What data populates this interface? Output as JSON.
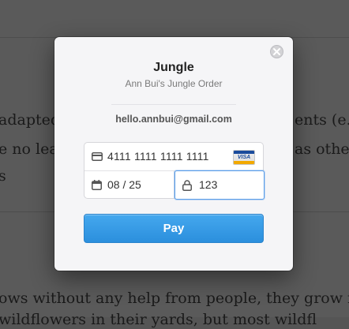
{
  "background": {
    "lines": [
      "adapted",
      "e no lea",
      "s",
      "ents (e.g",
      "as other",
      "ows without any help from people, they grow n",
      "wildflowers in their yards, but most wildfl"
    ]
  },
  "checkout": {
    "title": "Jungle",
    "subtitle": "Ann Bui's Jungle Order",
    "email": "hello.annbui@gmail.com",
    "card_number": "4111 1111 1111 1111",
    "card_brand": "VISA",
    "expiry": "08 / 25",
    "cvc": "123",
    "pay_label": "Pay",
    "colors": {
      "pay_button": "#3498e4",
      "focus_border": "#5b9ee8"
    }
  }
}
